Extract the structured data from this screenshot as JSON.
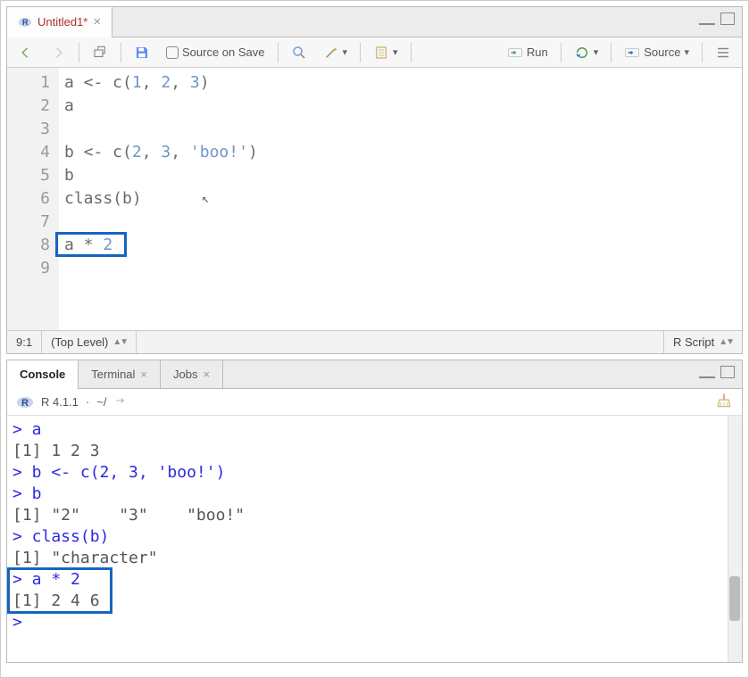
{
  "editorTab": {
    "title": "Untitled1*",
    "closeGlyph": "×"
  },
  "toolbar": {
    "sourceOnSave": "Source on Save",
    "run": "Run",
    "source": "Source"
  },
  "editor": {
    "lineNumbers": [
      "1",
      "2",
      "3",
      "4",
      "5",
      "6",
      "7",
      "8",
      "9"
    ],
    "lines": [
      {
        "raw": "a <- c(1, 2, 3)",
        "segs": [
          {
            "t": "a <- c(",
            "c": ""
          },
          {
            "t": "1",
            "c": "num"
          },
          {
            "t": ", ",
            "c": ""
          },
          {
            "t": "2",
            "c": "num"
          },
          {
            "t": ", ",
            "c": ""
          },
          {
            "t": "3",
            "c": "num"
          },
          {
            "t": ")",
            "c": ""
          }
        ]
      },
      {
        "raw": "a",
        "segs": [
          {
            "t": "a",
            "c": ""
          }
        ]
      },
      {
        "raw": "",
        "segs": []
      },
      {
        "raw": "b <- c(2, 3, 'boo!')",
        "segs": [
          {
            "t": "b <- c(",
            "c": ""
          },
          {
            "t": "2",
            "c": "num"
          },
          {
            "t": ", ",
            "c": ""
          },
          {
            "t": "3",
            "c": "num"
          },
          {
            "t": ", ",
            "c": ""
          },
          {
            "t": "'boo!'",
            "c": "str"
          },
          {
            "t": ")",
            "c": ""
          }
        ]
      },
      {
        "raw": "b",
        "segs": [
          {
            "t": "b",
            "c": ""
          }
        ]
      },
      {
        "raw": "class(b)",
        "segs": [
          {
            "t": "class(b)",
            "c": ""
          }
        ]
      },
      {
        "raw": "",
        "segs": []
      },
      {
        "raw": "a * 2",
        "segs": [
          {
            "t": "a * ",
            "c": ""
          },
          {
            "t": "2",
            "c": "num"
          }
        ]
      },
      {
        "raw": "",
        "segs": []
      }
    ],
    "highlightLine": 8
  },
  "status": {
    "pos": "9:1",
    "scope": "(Top Level)",
    "lang": "R Script"
  },
  "consoleTabs": {
    "console": "Console",
    "terminal": "Terminal",
    "jobs": "Jobs"
  },
  "consoleInfo": {
    "version": "R 4.1.1",
    "dot": "·",
    "path": "~/"
  },
  "consoleLines": [
    {
      "t": "> a",
      "c": "cin"
    },
    {
      "t": "[1] 1 2 3",
      "c": ""
    },
    {
      "t": "> b <- c(2, 3, 'boo!')",
      "c": "cin"
    },
    {
      "t": "> b",
      "c": "cin"
    },
    {
      "t": "[1] \"2\"    \"3\"    \"boo!\"",
      "c": ""
    },
    {
      "t": "> class(b)",
      "c": "cin"
    },
    {
      "t": "[1] \"character\"",
      "c": ""
    },
    {
      "t": "> a * 2",
      "c": "cin"
    },
    {
      "t": "[1] 2 4 6",
      "c": ""
    },
    {
      "t": "> ",
      "c": "cin"
    }
  ],
  "consoleHighlight": {
    "startLine": 7,
    "endLine": 8
  }
}
